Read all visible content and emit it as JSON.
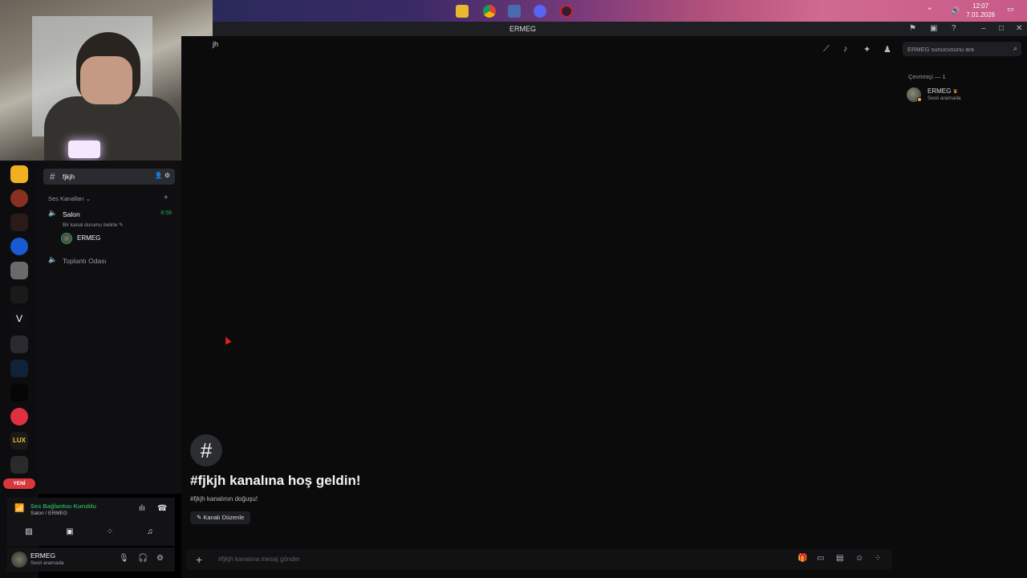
{
  "taskbar": {
    "time": "12:07",
    "date": "7.01.2026",
    "icons": [
      "file-explorer-icon",
      "chrome-icon",
      "app-icon",
      "discord-icon",
      "recording-icon"
    ]
  },
  "window": {
    "title": "ERMEG"
  },
  "header": {
    "channel_fragment": "jh",
    "search_placeholder": "ERMEG sunucusunu ara"
  },
  "members": {
    "section_title": "Çevrimiçi — 1",
    "list": [
      {
        "name": "ERMEG",
        "status": "Sesli aramada"
      }
    ]
  },
  "sidebar": {
    "active_channel": "fjkjh",
    "category": "Ses Kanalları",
    "voice_channels": [
      {
        "name": "Salon",
        "timer": "8:58",
        "status": "Bir kanal durumu belirle",
        "users": [
          "ERMEG"
        ]
      },
      {
        "name": "Toplantı Odası"
      }
    ]
  },
  "rail": {
    "new_badge": "YENİ"
  },
  "voice_panel": {
    "title": "Ses Bağlantısı Kuruldu",
    "subtitle": "Salon / ERMEG"
  },
  "user_panel": {
    "name": "ERMEG",
    "status": "Sesli aramada"
  },
  "welcome": {
    "title": "#fjkjh kanalına hoş geldin!",
    "subtitle": "#fjkjh kanalının doğuşu!",
    "edit_label": "Kanalı Düzenle"
  },
  "composer": {
    "placeholder": "#fjkjh kanalına mesaj gönder"
  },
  "colors": {
    "accent_green": "#23a55a",
    "danger_red": "#da373c",
    "crown_gold": "#f0b232"
  }
}
